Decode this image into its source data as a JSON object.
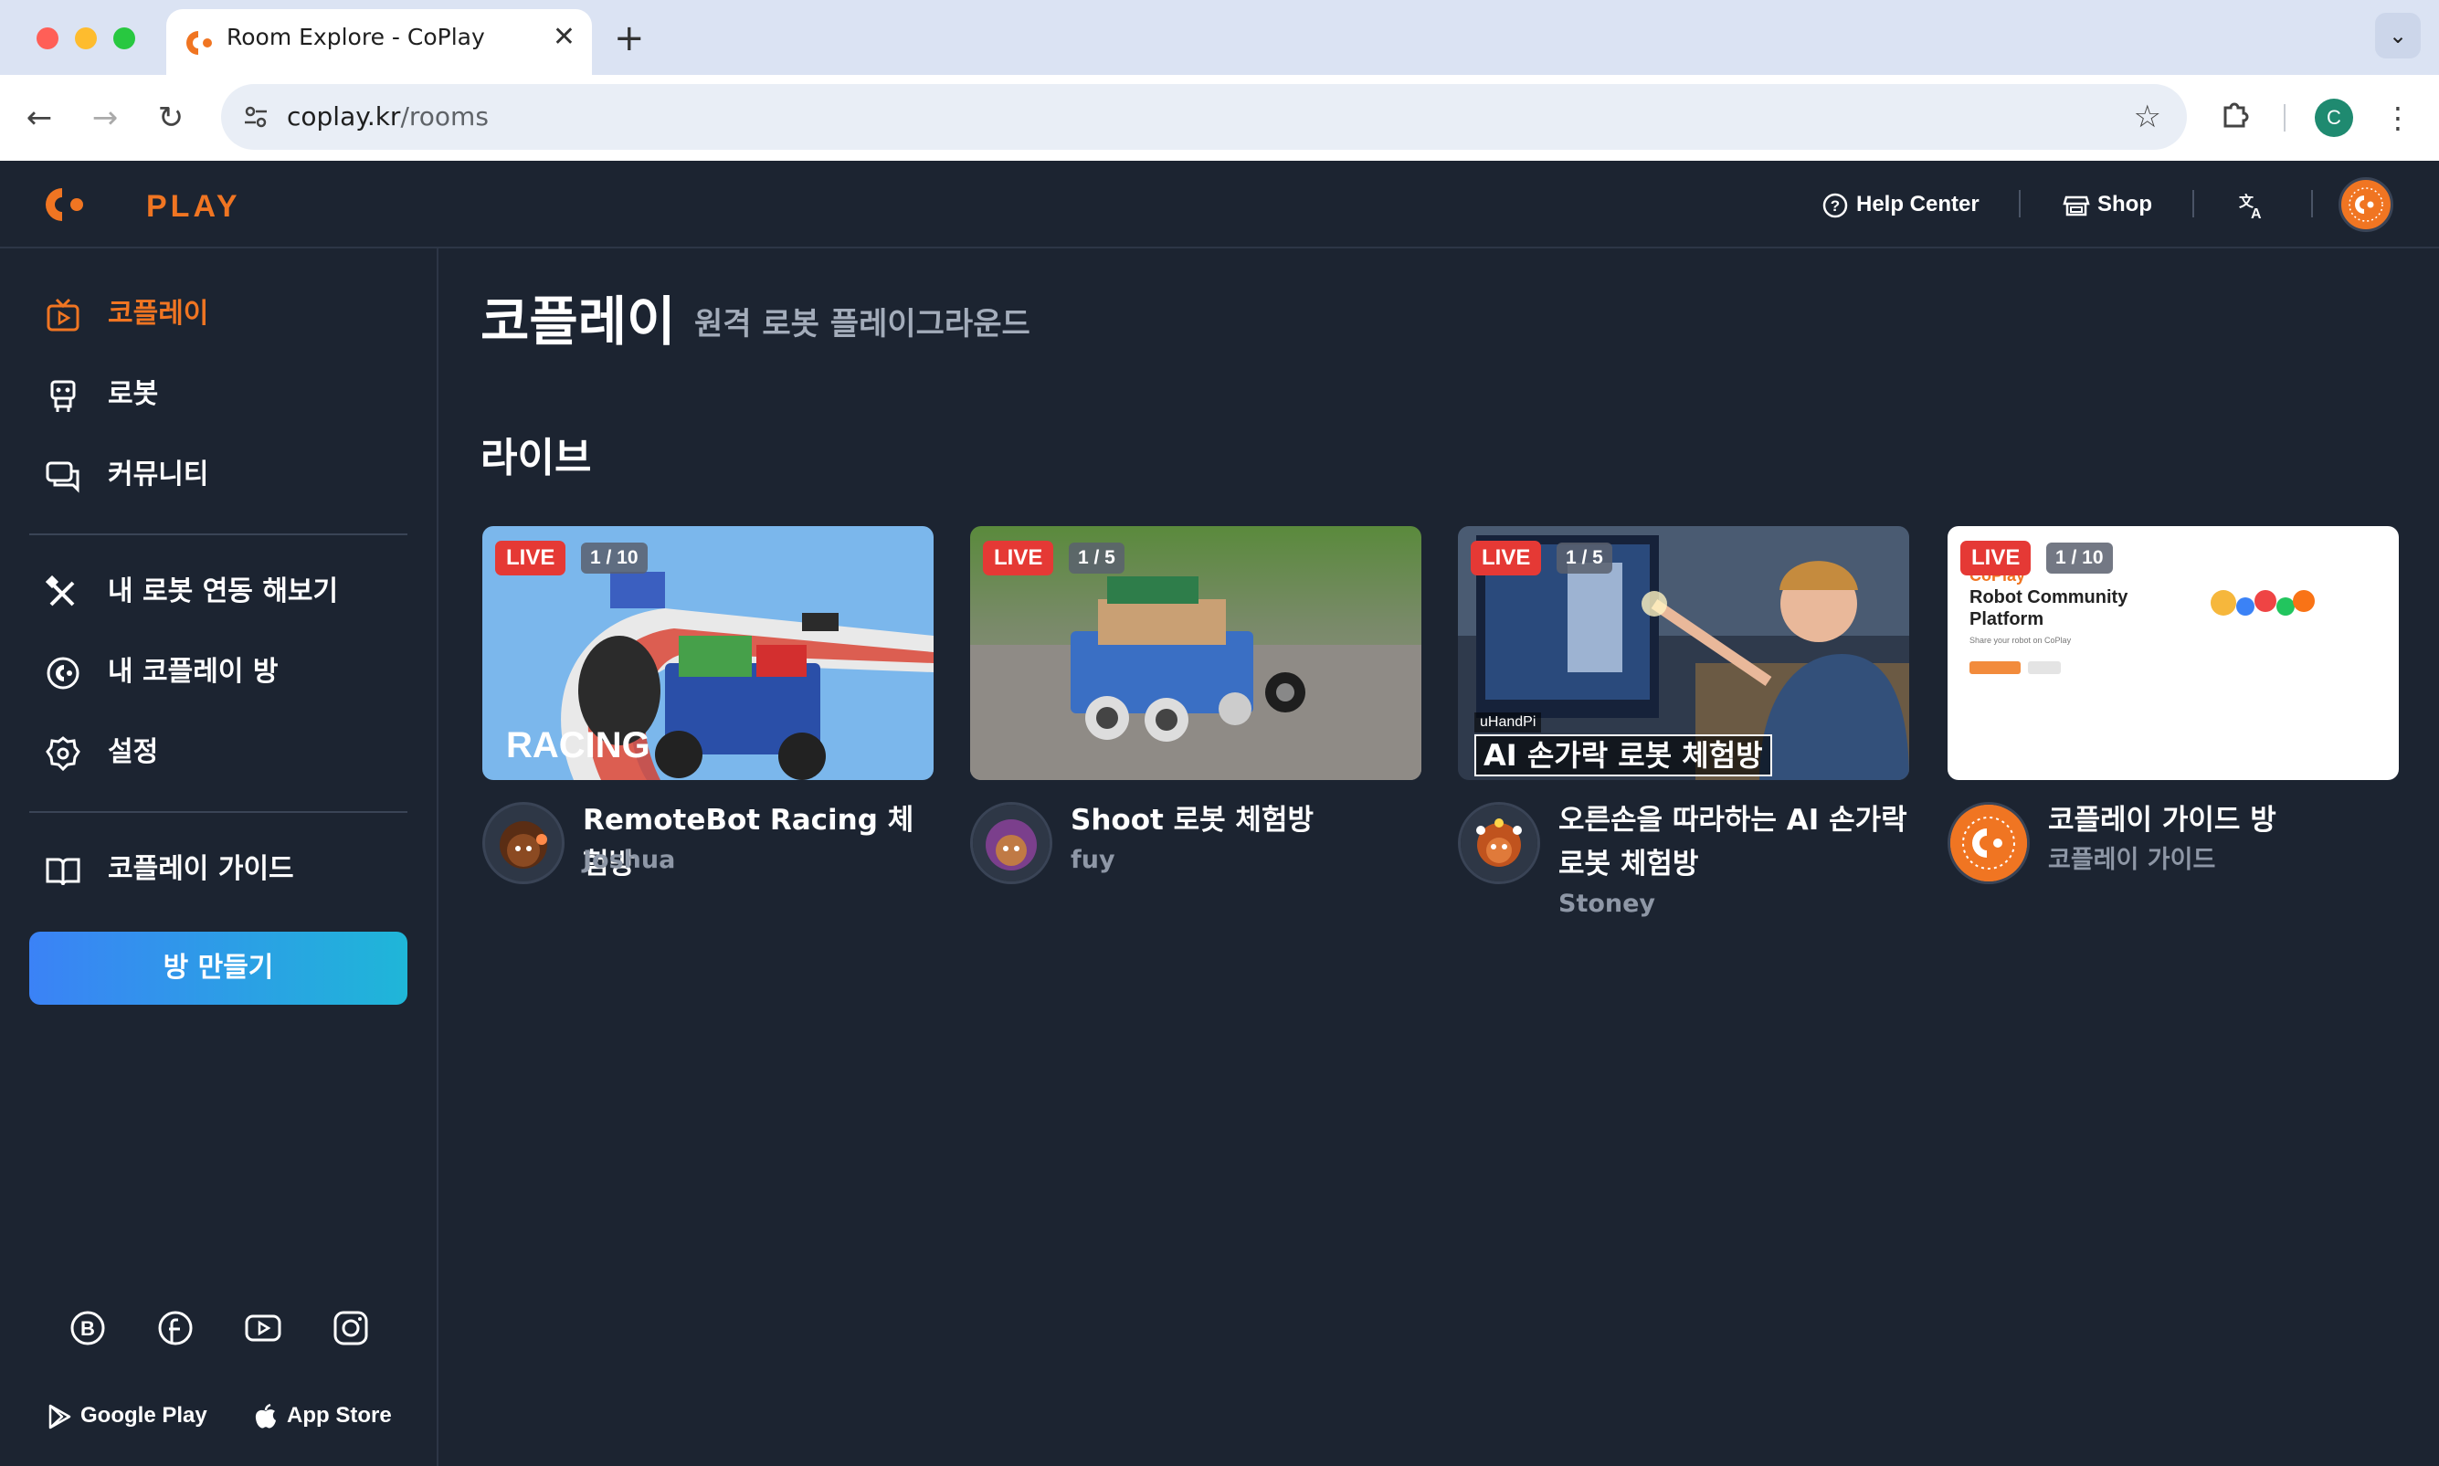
{
  "browser": {
    "tab_title": "Room Explore - CoPlay",
    "url_host": "coplay.kr",
    "url_path": "/rooms",
    "profile_initial": "C"
  },
  "header": {
    "logo_text": "PLAY",
    "help_center": "Help Center",
    "shop": "Shop",
    "translate_icon": "translate-icon"
  },
  "sidebar": {
    "items": [
      {
        "label": "코플레이",
        "icon": "tv-play-icon",
        "active": true
      },
      {
        "label": "로봇",
        "icon": "robot-icon"
      },
      {
        "label": "커뮤니티",
        "icon": "chat-icon"
      },
      {
        "label": "내 로봇 연동 해보기",
        "icon": "tools-icon"
      },
      {
        "label": "내 코플레이 방",
        "icon": "coplay-room-icon"
      },
      {
        "label": "설정",
        "icon": "gear-icon"
      },
      {
        "label": "코플레이 가이드",
        "icon": "book-icon"
      }
    ],
    "create_button": "방 만들기",
    "stores": {
      "google": "Google Play",
      "apple": "App Store"
    }
  },
  "main": {
    "title": "코플레이",
    "subtitle": "원격 로봇 플레이그라운드",
    "section_live": "라이브",
    "rooms": [
      {
        "title": "RemoteBot Racing 체험방",
        "owner": "Joshua",
        "live": "LIVE",
        "count": "1 / 10",
        "thumb_text": "RACING"
      },
      {
        "title": "Shoot 로봇 체험방",
        "owner": "fuy",
        "live": "LIVE",
        "count": "1 / 5"
      },
      {
        "title": "오른손을 따라하는 AI 손가락 로봇 체험방",
        "owner": "Stoney",
        "live": "LIVE",
        "count": "1 / 5",
        "thumb_small": "uHandPi",
        "thumb_caption": "AI 손가락 로봇 체험방"
      },
      {
        "title": "코플레이 가이드 방",
        "owner": "코플레이 가이드",
        "live": "LIVE",
        "count": "1 / 10",
        "thumb_heading": "Robot Community Platform",
        "thumb_tag": "CoPlay",
        "thumb_small": "Share your robot on CoPlay"
      }
    ]
  },
  "colors": {
    "accent": "#f07522",
    "live": "#e53935",
    "bg": "#1c2431"
  }
}
